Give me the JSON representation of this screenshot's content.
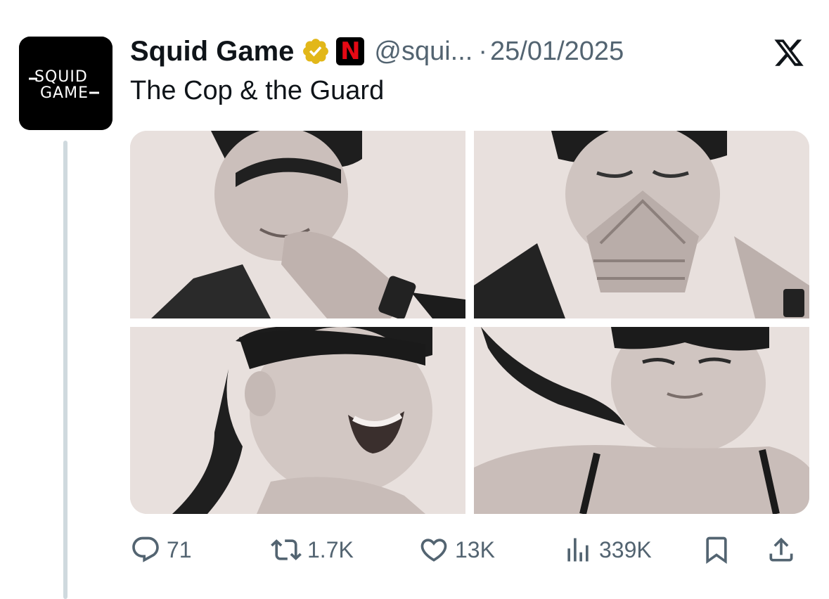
{
  "tweet": {
    "display_name": "Squid Game",
    "badge_letter": "N",
    "handle": "@squi...",
    "separator": "·",
    "date": "25/01/2025",
    "text": "The Cop & the Guard",
    "avatar_lines": [
      "SQUID",
      "GAME"
    ]
  },
  "icons": {
    "avatar": "squid-game-logo",
    "verified": "verified-badge-icon",
    "affiliate": "netflix-n-icon",
    "platform": "x-logo-icon",
    "reply": "reply-icon",
    "retweet": "retweet-icon",
    "like": "heart-icon",
    "views": "views-icon",
    "bookmark": "bookmark-icon",
    "share": "share-icon"
  },
  "actions": {
    "replies": "71",
    "retweets": "1.7K",
    "likes": "13K",
    "views": "339K"
  },
  "colors": {
    "verified_gold": "#e2b719",
    "netflix_red": "#e50914",
    "muted_text": "#536471",
    "thread_line": "#cfd9de"
  }
}
